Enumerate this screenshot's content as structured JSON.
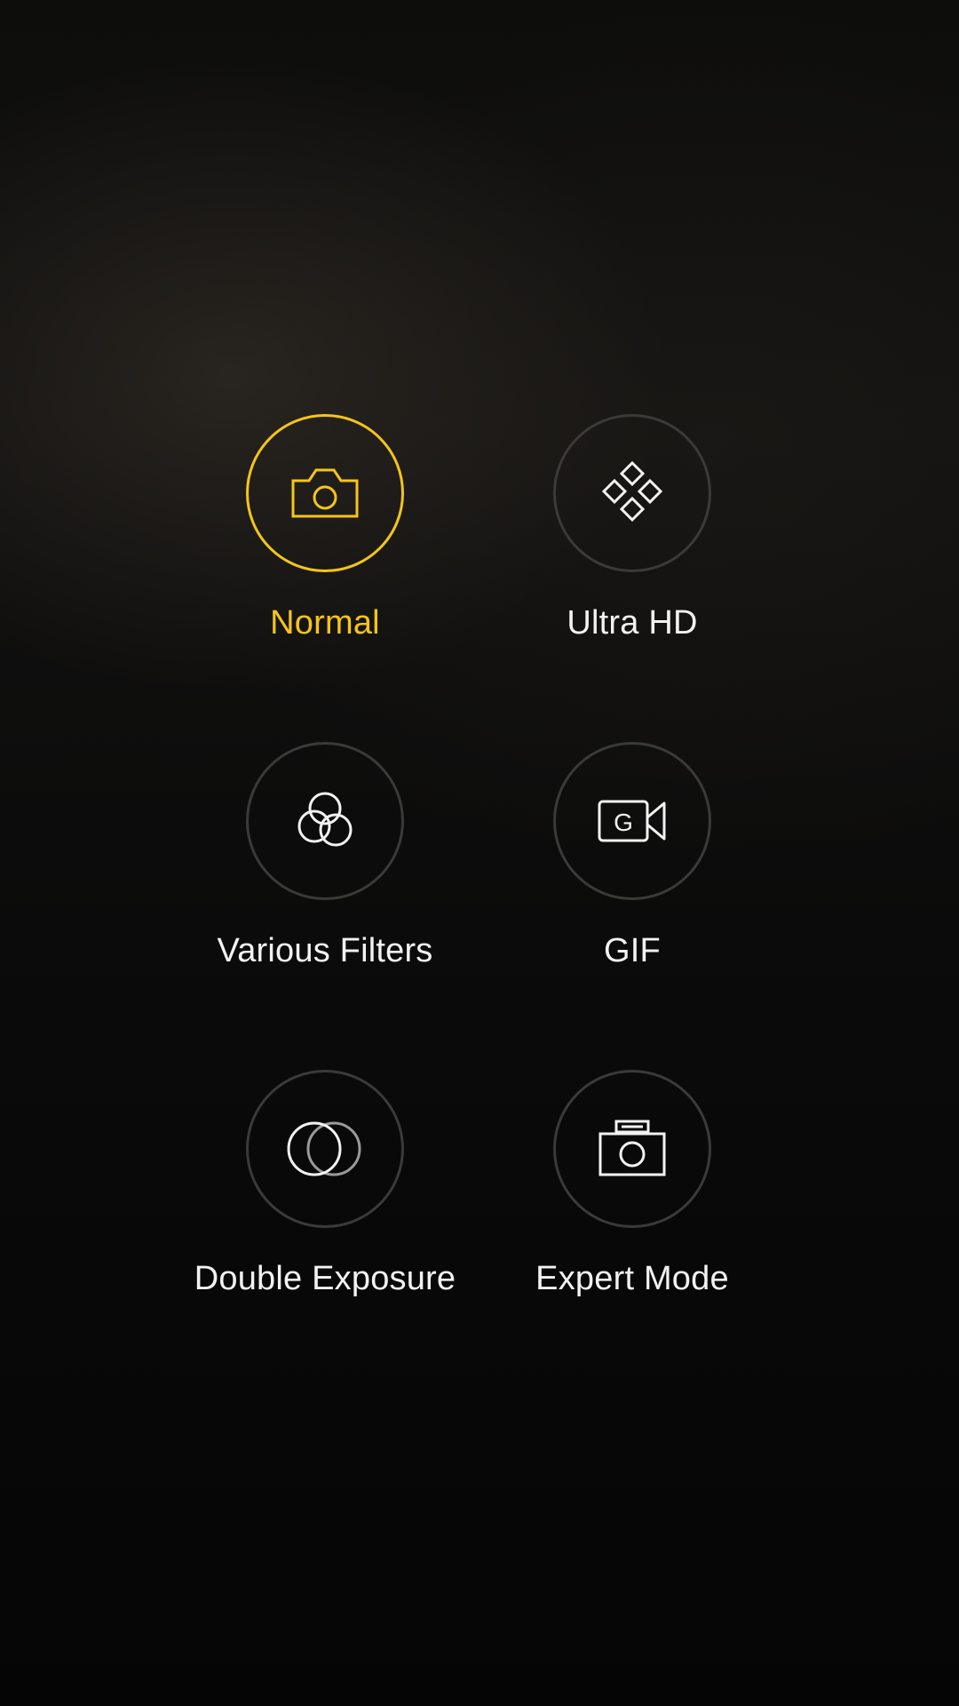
{
  "modes": [
    {
      "id": "normal",
      "label": "Normal",
      "icon": "camera-icon",
      "active": true
    },
    {
      "id": "ultra_hd",
      "label": "Ultra HD",
      "icon": "diamond-grid-icon",
      "active": false
    },
    {
      "id": "various_filters",
      "label": "Various Filters",
      "icon": "filters-circles-icon",
      "active": false
    },
    {
      "id": "gif",
      "label": "GIF",
      "icon": "gif-video-icon",
      "active": false
    },
    {
      "id": "double_exposure",
      "label": "Double Exposure",
      "icon": "double-exposure-icon",
      "active": false
    },
    {
      "id": "expert_mode",
      "label": "Expert Mode",
      "icon": "pro-camera-icon",
      "active": false
    }
  ],
  "colors": {
    "accent": "#f5c518",
    "text": "#f2f2f2",
    "ring": "#3a3a38",
    "background": "#0a0a0a"
  }
}
